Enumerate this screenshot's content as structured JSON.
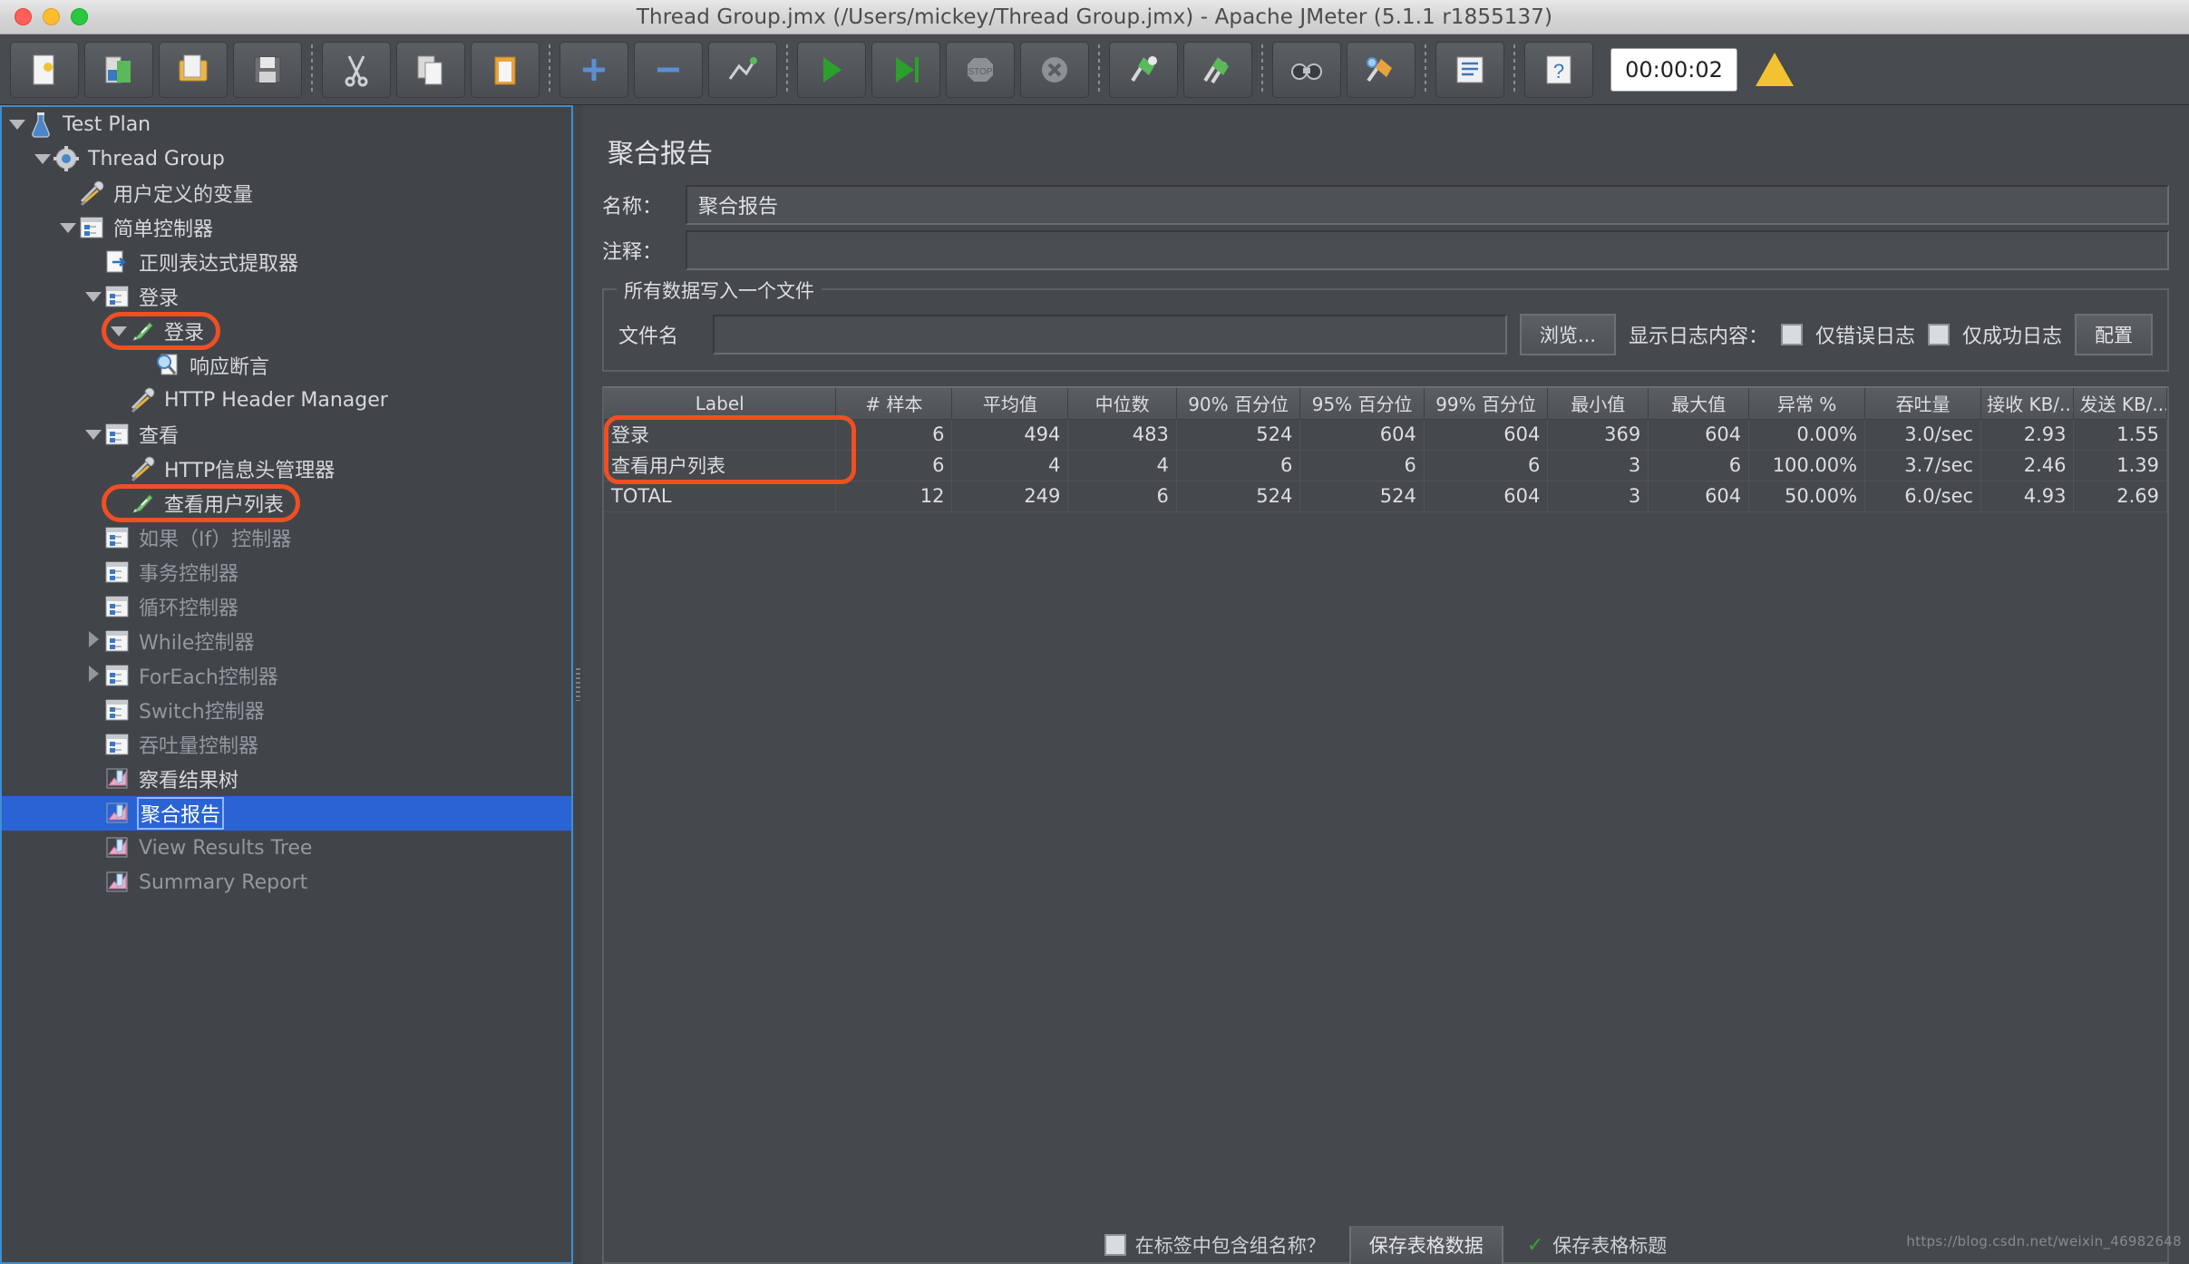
{
  "window": {
    "title": "Thread Group.jmx (/Users/mickey/Thread Group.jmx) - Apache JMeter (5.1.1 r1855137)"
  },
  "toolbar": {
    "buttons": [
      {
        "name": "new-button",
        "icon": "new-file-icon"
      },
      {
        "name": "templates-button",
        "icon": "templates-icon"
      },
      {
        "name": "open-button",
        "icon": "open-folder-icon"
      },
      {
        "name": "save-button",
        "icon": "save-disk-icon"
      },
      {
        "name": "cut-button",
        "icon": "scissors-icon"
      },
      {
        "name": "copy-button",
        "icon": "copy-icon"
      },
      {
        "name": "paste-button",
        "icon": "clipboard-icon"
      },
      {
        "name": "expand-all-button",
        "icon": "plus-icon"
      },
      {
        "name": "collapse-all-button",
        "icon": "minus-icon"
      },
      {
        "name": "toggle-button",
        "icon": "toggle-icon"
      },
      {
        "name": "start-button",
        "icon": "play-green-icon"
      },
      {
        "name": "start-no-pause-button",
        "icon": "play-no-pause-icon"
      },
      {
        "name": "stop-button",
        "icon": "stop-icon"
      },
      {
        "name": "shutdown-button",
        "icon": "shutdown-x-icon"
      },
      {
        "name": "clear-button",
        "icon": "clear-broom-icon"
      },
      {
        "name": "clear-all-button",
        "icon": "clear-all-broom-icon"
      },
      {
        "name": "search-button",
        "icon": "binoculars-icon"
      },
      {
        "name": "reset-search-button",
        "icon": "reset-search-icon"
      },
      {
        "name": "function-helper-button",
        "icon": "function-helper-icon"
      },
      {
        "name": "help-button",
        "icon": "question-help-icon"
      }
    ],
    "timer_value": "00:00:02",
    "warning_icon": "warning-triangle-icon"
  },
  "tree": {
    "items": [
      {
        "label": "Test Plan",
        "indent": 0,
        "twisty": "down",
        "icon": "test-plan-icon",
        "state": "normal"
      },
      {
        "label": "Thread Group",
        "indent": 1,
        "twisty": "down",
        "icon": "thread-group-icon",
        "state": "normal"
      },
      {
        "label": "用户定义的变量",
        "indent": 2,
        "twisty": "none",
        "icon": "config-icon",
        "state": "normal"
      },
      {
        "label": "简单控制器",
        "indent": 2,
        "twisty": "down",
        "icon": "controller-icon",
        "state": "normal"
      },
      {
        "label": "正则表达式提取器",
        "indent": 3,
        "twisty": "none",
        "icon": "extractor-icon",
        "state": "normal"
      },
      {
        "label": "登录",
        "indent": 3,
        "twisty": "down",
        "icon": "controller-icon",
        "state": "normal"
      },
      {
        "label": "登录",
        "indent": 4,
        "twisty": "down",
        "icon": "sampler-icon",
        "state": "normal",
        "highlight": true
      },
      {
        "label": "响应断言",
        "indent": 5,
        "twisty": "none",
        "icon": "assertion-icon",
        "state": "normal"
      },
      {
        "label": "HTTP Header Manager",
        "indent": 4,
        "twisty": "none",
        "icon": "config-icon",
        "state": "normal"
      },
      {
        "label": "查看",
        "indent": 3,
        "twisty": "down",
        "icon": "controller-icon",
        "state": "normal"
      },
      {
        "label": "HTTP信息头管理器",
        "indent": 4,
        "twisty": "none",
        "icon": "config-icon",
        "state": "normal"
      },
      {
        "label": "查看用户列表",
        "indent": 4,
        "twisty": "none",
        "icon": "sampler-icon",
        "state": "normal",
        "highlight": true
      },
      {
        "label": "如果（If）控制器",
        "indent": 3,
        "twisty": "none",
        "icon": "controller-icon",
        "state": "disabled"
      },
      {
        "label": "事务控制器",
        "indent": 3,
        "twisty": "none",
        "icon": "controller-icon",
        "state": "disabled"
      },
      {
        "label": "循环控制器",
        "indent": 3,
        "twisty": "none",
        "icon": "controller-icon",
        "state": "disabled"
      },
      {
        "label": "While控制器",
        "indent": 3,
        "twisty": "right",
        "icon": "controller-icon",
        "state": "disabled"
      },
      {
        "label": "ForEach控制器",
        "indent": 3,
        "twisty": "right",
        "icon": "controller-icon",
        "state": "disabled"
      },
      {
        "label": "Switch控制器",
        "indent": 3,
        "twisty": "none",
        "icon": "controller-icon",
        "state": "disabled"
      },
      {
        "label": "吞吐量控制器",
        "indent": 3,
        "twisty": "none",
        "icon": "controller-icon",
        "state": "disabled"
      },
      {
        "label": "察看结果树",
        "indent": 3,
        "twisty": "none",
        "icon": "listener-icon",
        "state": "normal"
      },
      {
        "label": "聚合报告",
        "indent": 3,
        "twisty": "none",
        "icon": "listener-icon",
        "state": "selected"
      },
      {
        "label": "View Results Tree",
        "indent": 3,
        "twisty": "none",
        "icon": "listener-icon",
        "state": "disabled"
      },
      {
        "label": "Summary Report",
        "indent": 3,
        "twisty": "none",
        "icon": "listener-icon",
        "state": "disabled"
      }
    ]
  },
  "panel": {
    "title": "聚合报告",
    "name_label": "名称：",
    "name_value": "聚合报告",
    "comment_label": "注释：",
    "comment_value": "",
    "group_title": "所有数据写入一个文件",
    "filename_label": "文件名",
    "filename_value": "",
    "browse_button": "浏览...",
    "log_content_label": "显示日志内容：",
    "errors_only_label": "仅错误日志",
    "success_only_label": "仅成功日志",
    "configure_button": "配置",
    "bottom_checkbox_label": "在标签中包含组名称？",
    "save_table_data_button": "保存表格数据",
    "save_table_header_label": "保存表格标题"
  },
  "chart_data": {
    "type": "table",
    "title": "聚合报告",
    "columns": [
      "Label",
      "# 样本",
      "平均值",
      "中位数",
      "90% 百分位",
      "95% 百分位",
      "99% 百分位",
      "最小值",
      "最大值",
      "异常 %",
      "吞吐量",
      "接收 KB/...",
      "发送 KB/..."
    ],
    "rows": [
      {
        "cells": [
          "登录",
          "6",
          "494",
          "483",
          "524",
          "604",
          "604",
          "369",
          "604",
          "0.00%",
          "3.0/sec",
          "2.93",
          "1.55"
        ],
        "highlight": true
      },
      {
        "cells": [
          "查看用户列表",
          "6",
          "4",
          "4",
          "6",
          "6",
          "6",
          "3",
          "6",
          "100.00%",
          "3.7/sec",
          "2.46",
          "1.39"
        ],
        "highlight": true
      },
      {
        "cells": [
          "TOTAL",
          "12",
          "249",
          "6",
          "524",
          "524",
          "604",
          "3",
          "604",
          "50.00%",
          "6.0/sec",
          "4.93",
          "2.69"
        ],
        "highlight": false
      }
    ]
  },
  "watermark": "https://blog.csdn.net/weixin_46982648",
  "colors": {
    "accent_blue": "#3e8fd0",
    "selection_blue": "#2a63d4",
    "highlight_orange": "#ef4f23",
    "panel_bg": "#45494d",
    "tree_bg": "#41454a"
  }
}
